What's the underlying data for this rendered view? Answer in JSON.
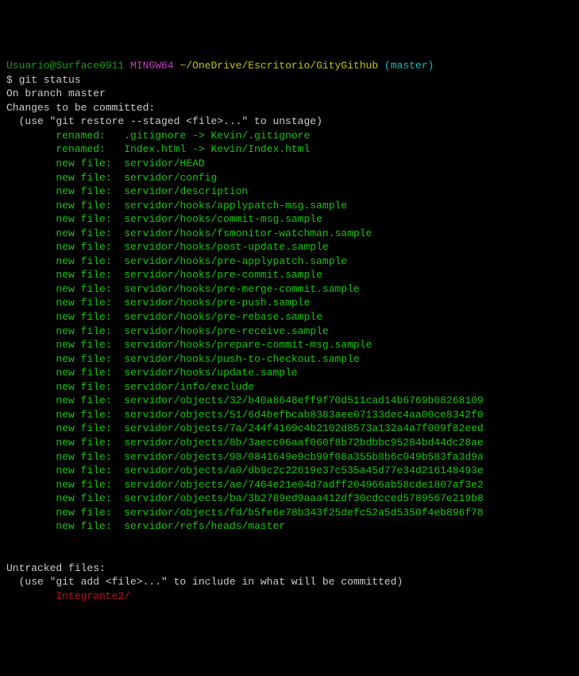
{
  "prompt": {
    "user_host": "Usuario@Surface0911",
    "shell": "MINGW64",
    "path": "~/OneDrive/Escritorio/GityGithub",
    "branch": "(master)"
  },
  "command": "$ git status",
  "branch_line": "On branch master",
  "staged_header": "Changes to be committed:",
  "staged_hint": "  (use \"git restore --staged <file>...\" to unstage)",
  "staged": [
    {
      "status": "renamed:   ",
      "path": ".gitignore -> Kevin/.gitignore"
    },
    {
      "status": "renamed:   ",
      "path": "Index.html -> Kevin/Index.html"
    },
    {
      "status": "new file:  ",
      "path": "servidor/HEAD"
    },
    {
      "status": "new file:  ",
      "path": "servidor/config"
    },
    {
      "status": "new file:  ",
      "path": "servidor/description"
    },
    {
      "status": "new file:  ",
      "path": "servidor/hooks/applypatch-msg.sample"
    },
    {
      "status": "new file:  ",
      "path": "servidor/hooks/commit-msg.sample"
    },
    {
      "status": "new file:  ",
      "path": "servidor/hooks/fsmonitor-watchman.sample"
    },
    {
      "status": "new file:  ",
      "path": "servidor/hooks/post-update.sample"
    },
    {
      "status": "new file:  ",
      "path": "servidor/hooks/pre-applypatch.sample"
    },
    {
      "status": "new file:  ",
      "path": "servidor/hooks/pre-commit.sample"
    },
    {
      "status": "new file:  ",
      "path": "servidor/hooks/pre-merge-commit.sample"
    },
    {
      "status": "new file:  ",
      "path": "servidor/hooks/pre-push.sample"
    },
    {
      "status": "new file:  ",
      "path": "servidor/hooks/pre-rebase.sample"
    },
    {
      "status": "new file:  ",
      "path": "servidor/hooks/pre-receive.sample"
    },
    {
      "status": "new file:  ",
      "path": "servidor/hooks/prepare-commit-msg.sample"
    },
    {
      "status": "new file:  ",
      "path": "servidor/hooks/push-to-checkout.sample"
    },
    {
      "status": "new file:  ",
      "path": "servidor/hooks/update.sample"
    },
    {
      "status": "new file:  ",
      "path": "servidor/info/exclude"
    },
    {
      "status": "new file:  ",
      "path": "servidor/objects/32/b40a8648eff9f70d511cad14b6769b08268109"
    },
    {
      "status": "new file:  ",
      "path": "servidor/objects/51/6d4befbcab8383aee07133dec4aa00ce8342f0"
    },
    {
      "status": "new file:  ",
      "path": "servidor/objects/7a/244f4169c4b2102d8573a132a4a7f009f82eed"
    },
    {
      "status": "new file:  ",
      "path": "servidor/objects/8b/3aecc06aaf060f8b72bdbbc95284bd44dc28ae"
    },
    {
      "status": "new file:  ",
      "path": "servidor/objects/98/0841649e9cb99f08a355b8b6c049b583fa3d9a"
    },
    {
      "status": "new file:  ",
      "path": "servidor/objects/a0/db9c2c22619e37c535a45d77e34d216148493e"
    },
    {
      "status": "new file:  ",
      "path": "servidor/objects/ae/7464e21e04d7adff204966ab58cde1807af3e2"
    },
    {
      "status": "new file:  ",
      "path": "servidor/objects/ba/3b2789ed9aaa412df30cdcced5789567e219b8"
    },
    {
      "status": "new file:  ",
      "path": "servidor/objects/fd/b5fe6e78b343f25defc52a5d5350f4eb896f78"
    },
    {
      "status": "new file:  ",
      "path": "servidor/refs/heads/master"
    }
  ],
  "untracked_header": "Untracked files:",
  "untracked_hint": "  (use \"git add <file>...\" to include in what will be committed)",
  "untracked": [
    "Integrante2/"
  ]
}
